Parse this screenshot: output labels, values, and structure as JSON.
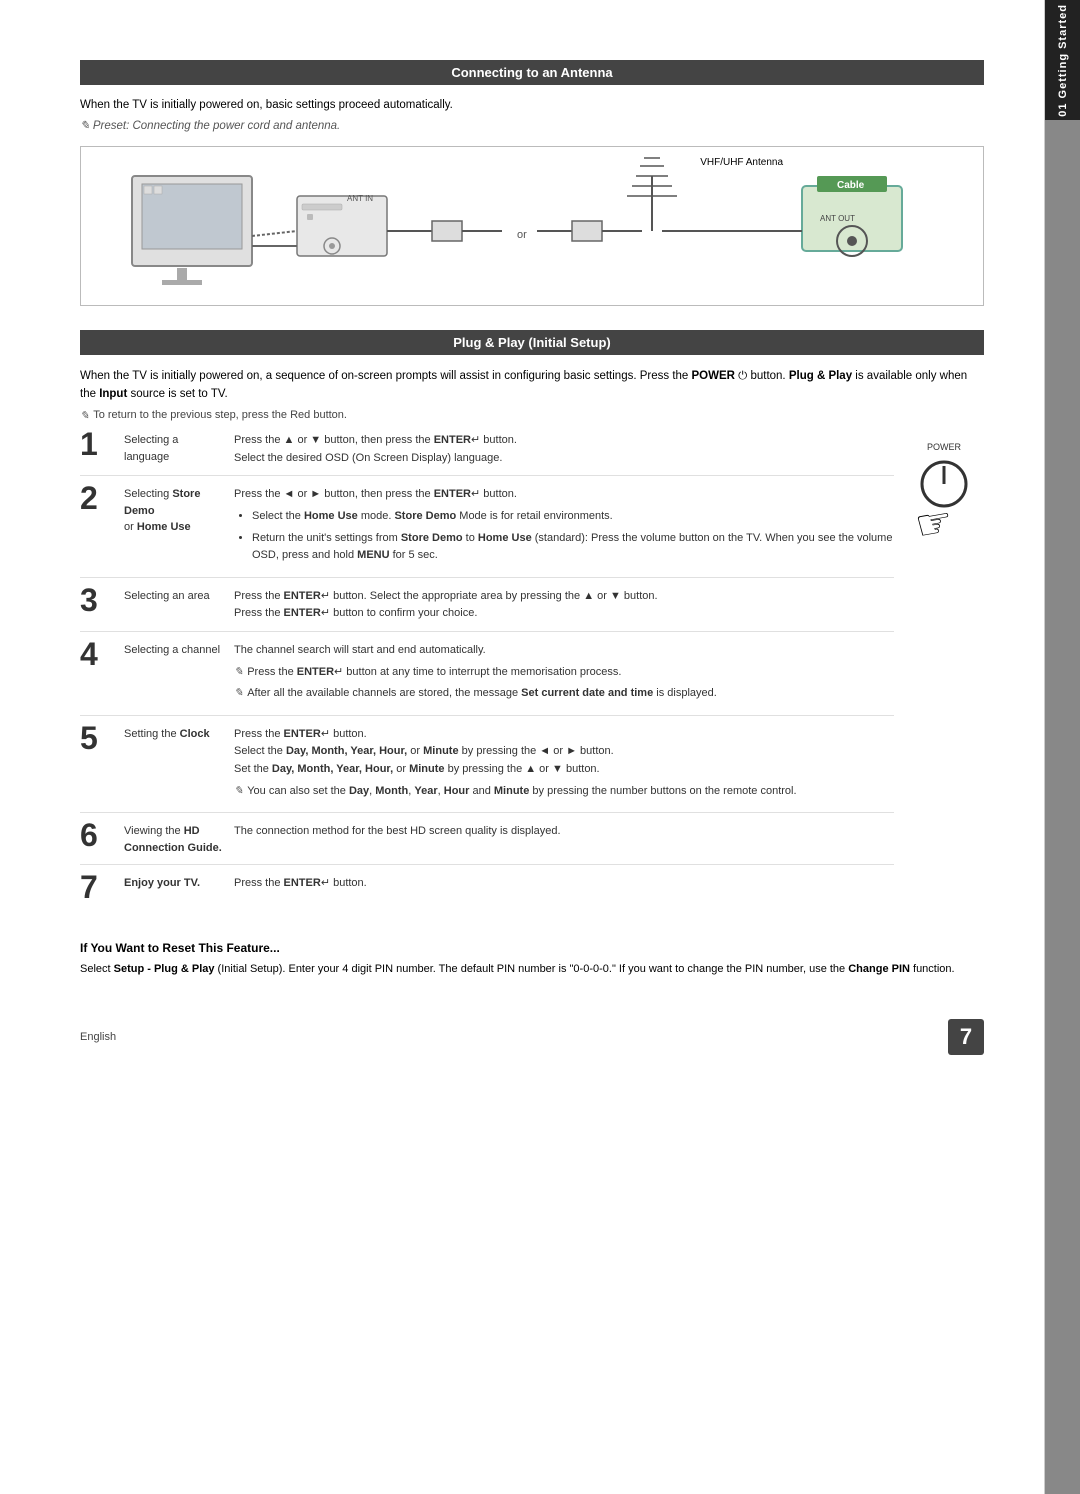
{
  "page": {
    "title": "Getting Started",
    "chapter_number": "01",
    "page_number": "7",
    "language": "English"
  },
  "antenna_section": {
    "header": "Connecting to an Antenna",
    "intro_text": "When the TV is initially powered on, basic settings proceed automatically.",
    "note": "Preset: Connecting the power cord and antenna.",
    "vhf_label": "VHF/UHF Antenna",
    "cable_label": "Cable",
    "ant_out_label": "ANT OUT",
    "or_text": "or"
  },
  "plug_section": {
    "header": "Plug & Play (Initial Setup)",
    "intro_text1": "When the TV is initially powered on, a sequence of on-screen prompts will assist in configuring basic settings. Press the",
    "intro_bold1": "POWER",
    "intro_text2": " button.",
    "intro_bold2": "Plug & Play",
    "intro_text3": " is available only when the ",
    "intro_bold3": "Input",
    "intro_text4": " source is set to TV.",
    "note": "To return to the previous step, press the Red button.",
    "power_label": "POWER"
  },
  "steps": [
    {
      "number": "1",
      "label": "Selecting a language",
      "description": "Press the ▲ or ▼ button, then press the ENTER button.\nSelect the desired OSD (On Screen Display) language."
    },
    {
      "number": "2",
      "label_normal": "Selecting ",
      "label_bold": "Store Demo",
      "label_normal2": " or ",
      "label_bold2": "Home Use",
      "description_intro": "Press the ◄ or ► button, then press the ENTER button.",
      "bullets": [
        "Select the Home Use mode. Store Demo Mode is for retail environments.",
        "Return the unit's settings from Store Demo to Home Use (standard): Press the volume button on the TV. When you see the volume OSD, press and hold MENU for 5 sec."
      ]
    },
    {
      "number": "3",
      "label": "Selecting an area",
      "description": "Press the ENTER button. Select the appropriate area by pressing the ▲ or ▼ button.\nPress the ENTER button to confirm your choice."
    },
    {
      "number": "4",
      "label": "Selecting a channel",
      "description": "The channel search will start and end automatically.",
      "notes": [
        "Press the ENTER button at any time to interrupt the memorisation process.",
        "After all the available channels are stored, the message Set current date and time is displayed."
      ]
    },
    {
      "number": "5",
      "label_normal": "Setting the ",
      "label_bold": "Clock",
      "description": "Press the ENTER button.\nSelect the Day, Month, Year, Hour, or Minute by pressing the ◄ or ► button.\nSet the Day, Month, Year, Hour, or Minute by pressing the ▲ or ▼ button.",
      "note": "You can also set the Day, Month, Year, Hour and Minute by pressing the number buttons on the remote control."
    },
    {
      "number": "6",
      "label_normal": "Viewing the ",
      "label_bold": "HD\nConnection Guide.",
      "description": "The connection method for the best HD screen quality is displayed."
    },
    {
      "number": "7",
      "label_bold": "Enjoy your TV.",
      "description": "Press the ENTER button."
    }
  ],
  "reset_section": {
    "title": "If You Want to Reset This Feature...",
    "text": "Select Setup - Plug & Play (Initial Setup). Enter your 4 digit PIN number. The default PIN number is \"0-0-0-0.\" If you want to change the PIN number, use the Change PIN function."
  }
}
